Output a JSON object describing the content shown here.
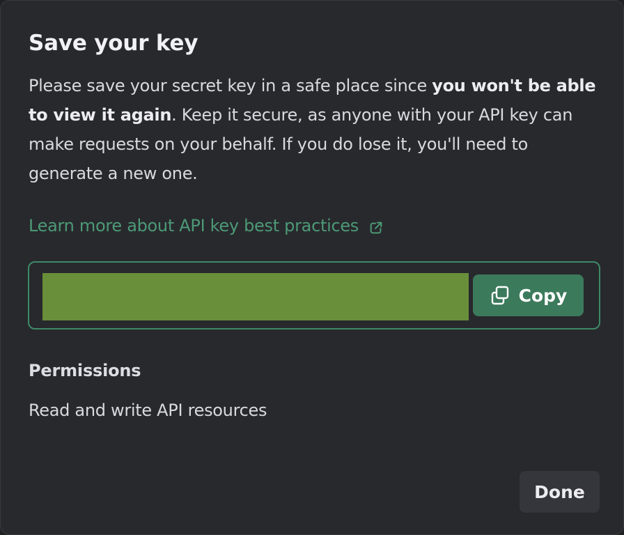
{
  "dialog": {
    "title": "Save your key",
    "description": {
      "part1": "Please save your secret key in a safe place since ",
      "emphasis": "you won't be able to view it again",
      "part2": ". Keep it secure, as anyone with your API key can make requests on your behalf. If you do lose it, you'll need to generate a new one."
    },
    "learn_link": {
      "label": "Learn more about API key best practices",
      "icon": "external-link-icon"
    },
    "key_field": {
      "value": ""
    },
    "copy_button": {
      "label": "Copy",
      "icon": "copy-icon"
    },
    "permissions": {
      "heading": "Permissions",
      "value": "Read and write API resources"
    },
    "done_button": {
      "label": "Done"
    }
  },
  "colors": {
    "background": "#28292d",
    "accent": "#3e8a68",
    "link": "#4c9a77",
    "key_redaction": "#6a8f3a",
    "copy_button": "#3c7a5c",
    "done_button": "#35363b"
  }
}
